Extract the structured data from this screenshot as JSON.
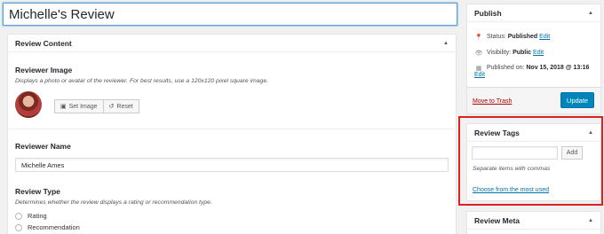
{
  "title_input": {
    "value": "Michelle's Review"
  },
  "review_content": {
    "heading": "Review Content",
    "reviewer_image": {
      "title": "Reviewer Image",
      "description": "Displays a photo or avatar of the reviewer. For best results, use a 120x120 pixel square image.",
      "set_image_label": "Set Image",
      "reset_label": "Reset"
    },
    "reviewer_name": {
      "title": "Reviewer Name",
      "value": "Michelle Ames"
    },
    "review_type": {
      "title": "Review Type",
      "description": "Determines whether the review displays a rating or recommendation type.",
      "options": [
        "Rating",
        "Recommendation"
      ]
    }
  },
  "publish": {
    "heading": "Publish",
    "status_label": "Status:",
    "status_value": "Published",
    "visibility_label": "Visibility:",
    "visibility_value": "Public",
    "published_label": "Published on:",
    "published_value": "Nov 15, 2018 @ 13:16",
    "edit_label": "Edit",
    "trash_label": "Move to Trash",
    "update_label": "Update"
  },
  "review_tags": {
    "heading": "Review Tags",
    "add_label": "Add",
    "help": "Separate items with commas",
    "choose_link": "Choose from the most used"
  },
  "review_meta": {
    "heading": "Review Meta"
  },
  "colors": {
    "accent": "#0085ba",
    "link": "#0073aa",
    "highlight": "#e02020",
    "trash": "#a00000"
  }
}
